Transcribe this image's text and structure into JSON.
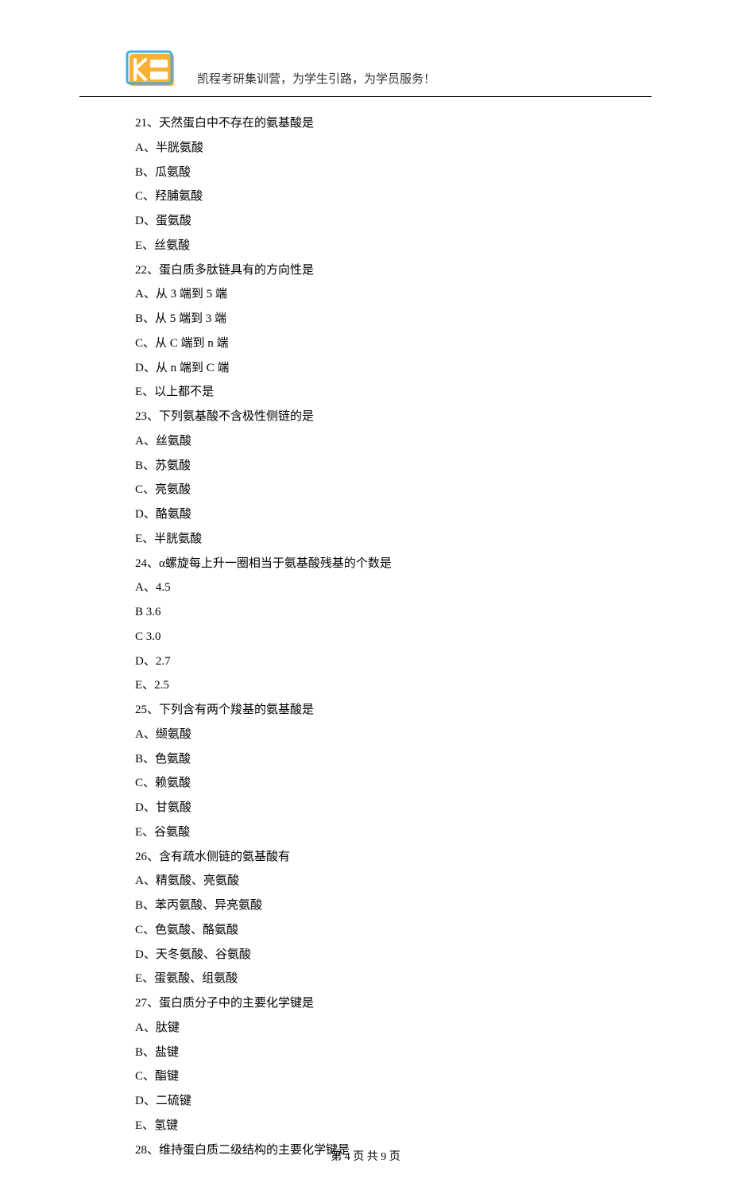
{
  "header": {
    "slogan": "凯程考研集训营，为学生引路，为学员服务！"
  },
  "lines": [
    "21、天然蛋白中不存在的氨基酸是",
    "A、半胱氨酸",
    "B、瓜氨酸",
    "C、羟脯氨酸",
    "D、蛋氨酸",
    "E、丝氨酸",
    "22、蛋白质多肽链具有的方向性是",
    "A、从 3 端到 5 端",
    "B、从 5 端到 3 端",
    "C、从 C 端到 n 端",
    "D、从 n 端到 C 端",
    "E、以上都不是",
    "23、下列氨基酸不含极性侧链的是",
    "A、丝氨酸",
    "B、苏氨酸",
    "C、亮氨酸",
    "D、酪氨酸",
    "E、半胱氨酸",
    "24、α螺旋每上升一圈相当于氨基酸残基的个数是",
    "A、4.5",
    "B 3.6",
    "C 3.0",
    "D、2.7",
    "E、2.5",
    "25、下列含有两个羧基的氨基酸是",
    "A、缬氨酸",
    "B、色氨酸",
    "C、赖氨酸",
    "D、甘氨酸",
    "E、谷氨酸",
    "26、含有疏水侧链的氨基酸有",
    "A、精氨酸、亮氨酸",
    "B、苯丙氨酸、异亮氨酸",
    "C、色氨酸、酪氨酸",
    "D、天冬氨酸、谷氨酸",
    "E、蛋氨酸、组氨酸",
    "27、蛋白质分子中的主要化学键是",
    "A、肽键",
    "B、盐键",
    "C、酯键",
    "D、二硫键",
    "E、氢键",
    "28、维持蛋白质二级结构的主要化学键是"
  ],
  "footer": {
    "text": "第 4 页 共 9 页"
  }
}
